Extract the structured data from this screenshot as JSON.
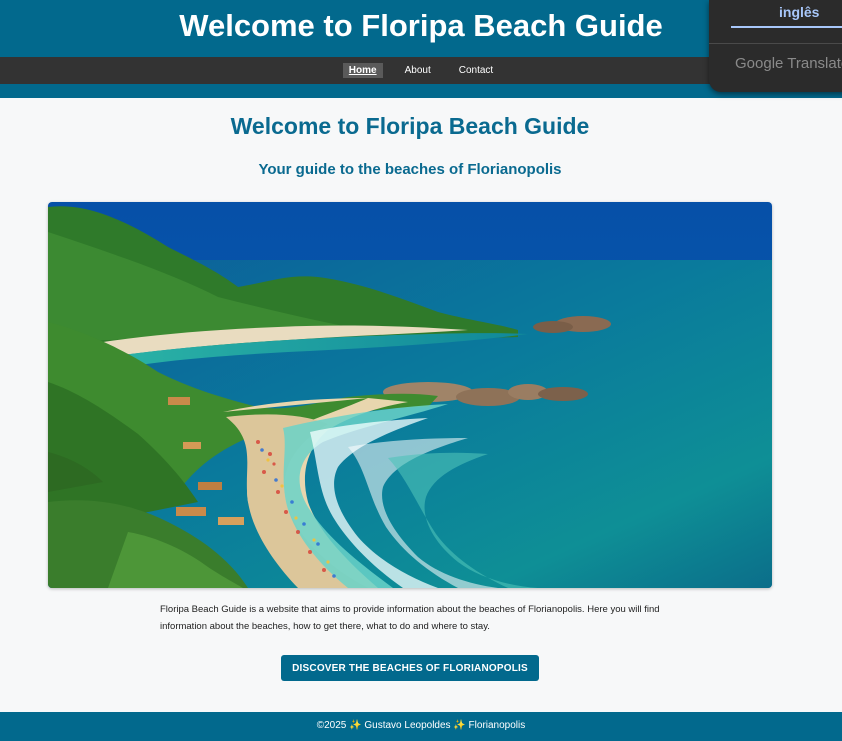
{
  "header": {
    "title": "Welcome to Floripa Beach Guide"
  },
  "nav": {
    "items": [
      {
        "label": "Home"
      },
      {
        "label": "About"
      },
      {
        "label": "Contact"
      }
    ]
  },
  "main": {
    "title": "Welcome to Floripa Beach Guide",
    "subtitle": "Your guide to the beaches of Florianopolis",
    "intro": "Floripa Beach Guide is a website that aims to provide information about the beaches of Florianopolis. Here you will find information about the beaches, how to get there, what to do and where to stay.",
    "cta_label": "DISCOVER THE BEACHES OF FLORIANOPOLIS"
  },
  "footer": {
    "text": "©2025 ✨ Gustavo Leopoldes ✨ Florianopolis"
  },
  "translate_widget": {
    "language": "inglês",
    "brand": "Google Translate"
  },
  "colors": {
    "brand": "#02698d",
    "nav": "#333333",
    "heading": "#0a6a90",
    "page_bg": "#f7f8f9"
  }
}
